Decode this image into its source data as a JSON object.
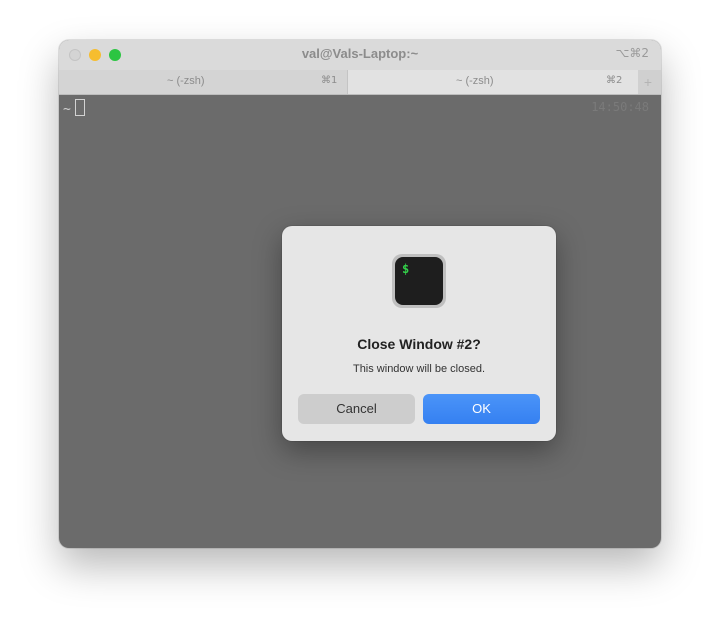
{
  "window": {
    "title": "val@Vals-Laptop:~",
    "title_shortcut": "⌥⌘2"
  },
  "tabs": [
    {
      "label": "~ (-zsh)",
      "shortcut": "⌘1",
      "active": false
    },
    {
      "label": "~ (-zsh)",
      "shortcut": "⌘2",
      "active": true
    }
  ],
  "new_tab_icon": "+",
  "terminal": {
    "prompt": "~",
    "clock": "14:50:48"
  },
  "dialog": {
    "icon": "terminal-app-icon",
    "icon_glyph": "$",
    "title": "Close Window #2?",
    "message": "This window will be closed.",
    "cancel_label": "Cancel",
    "ok_label": "OK"
  },
  "colors": {
    "accent": "#3d8af7",
    "traffic_minimize": "#f6bd2f",
    "traffic_maximize": "#2cc542",
    "terminal_bg": "#6b6b6b"
  }
}
